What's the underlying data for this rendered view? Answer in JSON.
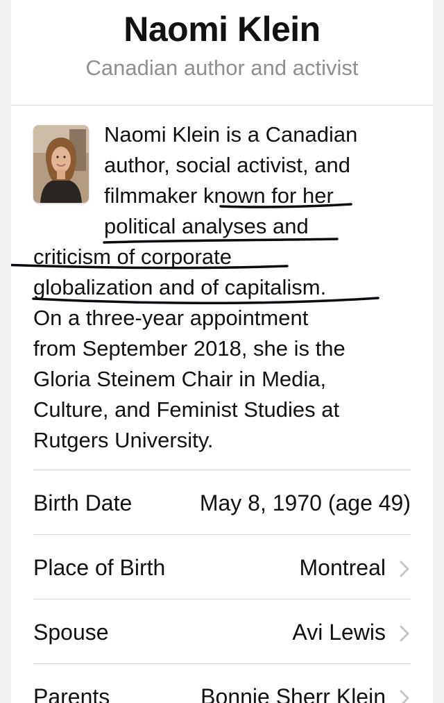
{
  "header": {
    "title": "Naomi Klein",
    "subtitle": "Canadian author and activist"
  },
  "summary": {
    "lines": [
      "Naomi Klein is a Canadian",
      "author, social activist, and",
      "filmmaker known for her",
      "political analyses and",
      "criticism of corporate",
      "globalization and of capitalism.",
      "On a three-year appointment",
      "from September 2018, she is the",
      "Gloria Steinem Chair in Media,",
      "Culture, and Feminist Studies at",
      "Rutgers University."
    ]
  },
  "facts": [
    {
      "label": "Birth Date",
      "value": "May 8, 1970 (age 49)"
    },
    {
      "label": "Place of Birth",
      "value": "Montreal"
    },
    {
      "label": "Spouse",
      "value": "Avi Lewis"
    },
    {
      "label": "Parents",
      "value": "Bonnie Sherr Klein"
    }
  ],
  "icons": {
    "photo": "portrait-photo",
    "disclosure": "chevron-right-icon"
  },
  "colors": {
    "secondary_text": "#8e8e93",
    "separator": "#d1d1d6",
    "chevron": "#c4c4c9",
    "annotation_ink": "#0c0c10"
  }
}
